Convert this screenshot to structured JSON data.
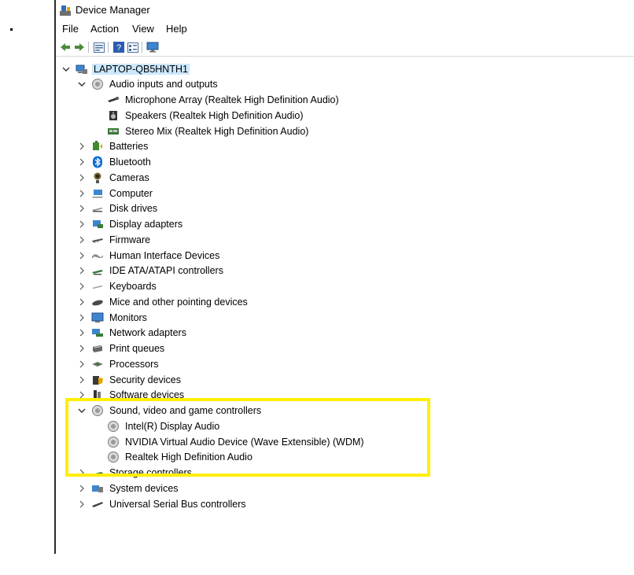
{
  "window": {
    "title": "Device Manager"
  },
  "menu": [
    "File",
    "Action",
    "View",
    "Help"
  ],
  "toolbar": [
    "back-icon",
    "forward-icon",
    "properties-icon",
    "help-icon",
    "view-icon",
    "monitor-icon"
  ],
  "tree": {
    "root": "LAPTOP-QB5HNTH1",
    "audio_inputs": {
      "label": "Audio inputs and outputs",
      "children": [
        "Microphone Array (Realtek High Definition Audio)",
        "Speakers (Realtek High Definition Audio)",
        "Stereo Mix (Realtek High Definition Audio)"
      ]
    },
    "categories_a": [
      "Batteries",
      "Bluetooth",
      "Cameras",
      "Computer",
      "Disk drives",
      "Display adapters",
      "Firmware",
      "Human Interface Devices",
      "IDE ATA/ATAPI controllers",
      "Keyboards",
      "Mice and other pointing devices",
      "Monitors",
      "Network adapters",
      "Print queues",
      "Processors",
      "Security devices",
      "Software devices"
    ],
    "sound": {
      "label": "Sound, video and game controllers",
      "children": [
        "Intel(R) Display Audio",
        "NVIDIA Virtual Audio Device (Wave Extensible) (WDM)",
        "Realtek High Definition Audio"
      ]
    },
    "categories_b": [
      "Storage controllers",
      "System devices",
      "Universal Serial Bus controllers"
    ]
  },
  "colors": {
    "highlight": "#ffef00",
    "selection": "#cce8ff"
  }
}
